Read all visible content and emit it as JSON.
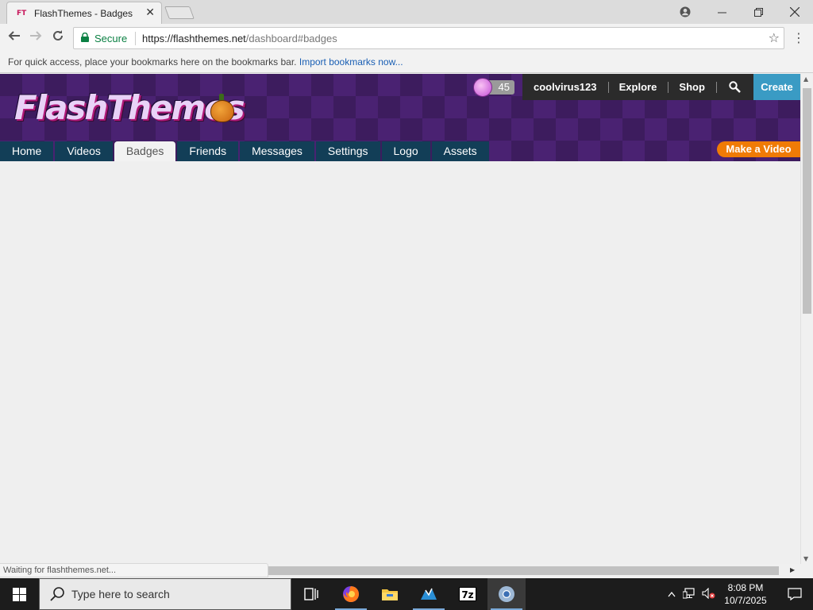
{
  "browser": {
    "tab_title": "FlashThemes - Badges",
    "tab_favicon": "FT",
    "secure_label": "Secure",
    "url_base": "https://flashthemes.net",
    "url_path": "/dashboard#badges",
    "bookmarks_text": "For quick access, place your bookmarks here on the bookmarks bar.",
    "bookmarks_link": "Import bookmarks now...",
    "status_text": "Waiting for flashthemes.net..."
  },
  "site": {
    "logo_text": "FlashThemes",
    "coins": "45",
    "user_nav": {
      "username": "coolvirus123",
      "explore": "Explore",
      "shop": "Shop",
      "create": "Create"
    },
    "tabs": [
      {
        "label": "Home",
        "active": false
      },
      {
        "label": "Videos",
        "active": false
      },
      {
        "label": "Badges",
        "active": true
      },
      {
        "label": "Friends",
        "active": false
      },
      {
        "label": "Messages",
        "active": false
      },
      {
        "label": "Settings",
        "active": false
      },
      {
        "label": "Logo",
        "active": false
      },
      {
        "label": "Assets",
        "active": false
      }
    ],
    "make_video": "Make a Video"
  },
  "taskbar": {
    "search_placeholder": "Type here to search",
    "time": "8:08 PM",
    "date": "10/7/2025",
    "sevenzip_label": "7z"
  },
  "colors": {
    "header_bg": "#3d1c5e",
    "nav_tab": "#123e57",
    "create_btn": "#3a9bc4",
    "make_video_btn": "#f07b06",
    "secure_green": "#0b8043"
  }
}
